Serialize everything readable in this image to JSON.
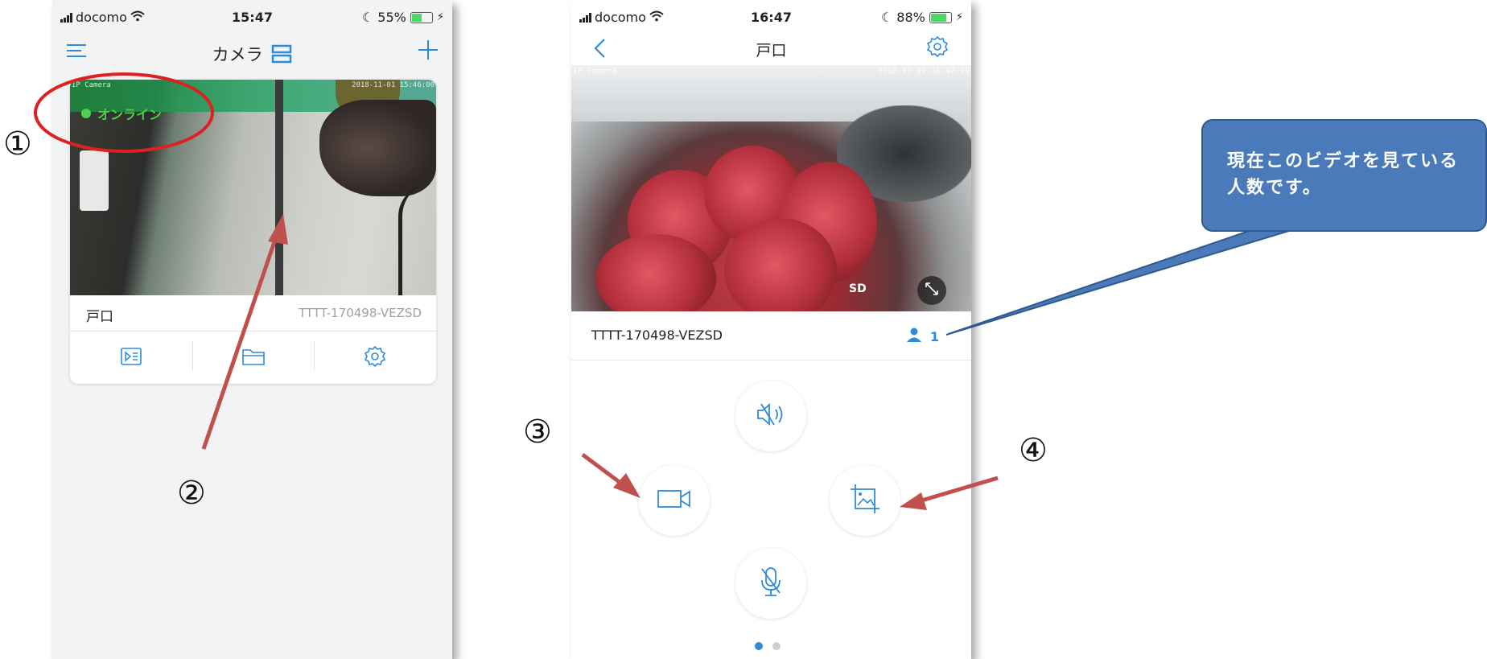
{
  "left_screen": {
    "status": {
      "carrier": "docomo",
      "time": "15:47",
      "battery_text": "55%",
      "battery_level": 0.55
    },
    "nav": {
      "title": "カメラ",
      "menu_icon": "hamburger-icon",
      "layout_icon": "layout-icon",
      "add_icon": "plus-icon"
    },
    "card": {
      "online_label": "オンライン",
      "osd_camera": "IP Camera",
      "osd_time": "2018-11-01 15:46:00",
      "name": "戸口",
      "device_id": "TTTT-170498-VEZSD",
      "actions": [
        "playback-icon",
        "folder-icon",
        "gear-icon"
      ]
    }
  },
  "right_screen": {
    "status": {
      "carrier": "docomo",
      "time": "16:47",
      "battery_text": "88%",
      "battery_level": 0.88
    },
    "nav": {
      "title": "戸口",
      "back_icon": "chevron-left-icon",
      "settings_icon": "gear-icon"
    },
    "video": {
      "osd_camera": "IP Camera",
      "osd_time": "2018-11-01 16:47:19",
      "quality": "SD"
    },
    "device_id": "TTTT-170498-VEZSD",
    "viewers": "1",
    "controls": [
      "mute-icon",
      "record-icon",
      "snapshot-icon",
      "microphone-icon"
    ],
    "pager": {
      "pages": 2,
      "active": 0
    }
  },
  "annotations": {
    "markers": [
      "①",
      "②",
      "③",
      "④"
    ],
    "callout_text": "現在このビデオを見ている人数です。"
  },
  "colors": {
    "accent": "#2d8bd9",
    "online": "#4dd04d",
    "arrow": "#c0504d",
    "callout": "#4a7ab9",
    "circle": "#e02020"
  }
}
